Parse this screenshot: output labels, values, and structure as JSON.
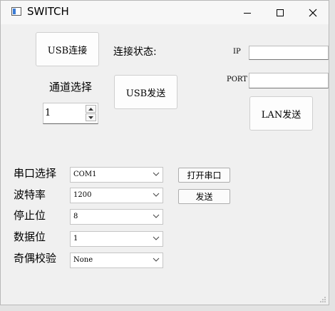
{
  "window": {
    "title": "SWITCH"
  },
  "usb": {
    "connect_label": "USB连接",
    "status_label": "连接状态:",
    "channel_label": "通道选择",
    "channel_value": "1",
    "send_label": "USB发送"
  },
  "lan": {
    "ip_label": "IP",
    "ip_value": "",
    "port_label": "PORT",
    "port_value": "",
    "send_label": "LAN发送"
  },
  "serial": {
    "port_label": "串口选择",
    "port_value": "COM1",
    "baud_label": "波特率",
    "baud_value": "1200",
    "stop_label": "停止位",
    "stop_value": "8",
    "data_label": "数据位",
    "data_value": "1",
    "parity_label": "奇偶校验",
    "parity_value": "None",
    "open_label": "打开串口",
    "send_label": "发送"
  },
  "colors": {
    "window_bg": "#f0f0f0",
    "titlebar_bg": "#f7f7f7",
    "desktop_bg": "#d9d9d9"
  }
}
